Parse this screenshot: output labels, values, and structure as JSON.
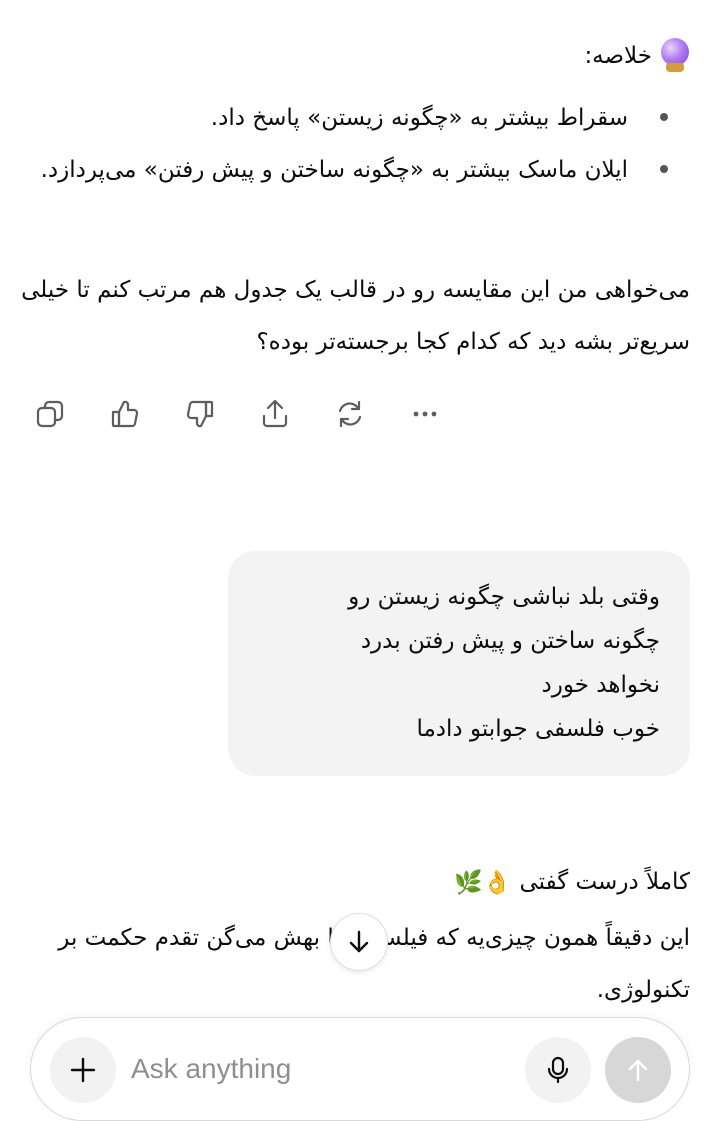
{
  "assistant_message_1": {
    "summary_title": "خلاصه:",
    "summary_icon": "crystal-ball-icon",
    "bullets": [
      "سقراط بیشتر به «چگونه زیستن» پاسخ داد.",
      "ایلان ماسک بیشتر به «چگونه ساختن و پیش رفتن» می‌پردازد."
    ],
    "question": "می‌خواهی من این مقایسه رو در قالب یک جدول هم مرتب کنم تا خیلی سریع‌تر بشه دید که کدام کجا برجسته‌تر بوده؟",
    "actions": [
      "copy-icon",
      "thumbs-up-icon",
      "thumbs-down-icon",
      "share-icon",
      "regenerate-icon",
      "more-icon"
    ]
  },
  "user_message": {
    "lines": [
      "وقتی بلد نباشی چگونه زیستن رو",
      "چگونه ساختن و پیش رفتن بدرد",
      "نخواهد خورد",
      "خوب فلسفی جوابتو دادما"
    ]
  },
  "assistant_message_2": {
    "title": "کاملاً درست گفتی",
    "title_emoji": "👌🌿",
    "body": "این دقیقاً همون چیزی‌یه که فیلسوف‌ها بهش می‌گن تقدم حکمت بر تکنولوژی."
  },
  "composer": {
    "placeholder": "Ask anything",
    "add_icon": "plus-icon",
    "mic_icon": "microphone-icon",
    "send_icon": "arrow-up-icon"
  },
  "colors": {
    "text": "#0d0d0d",
    "bubble": "#f3f3f3",
    "icon": "#5d5d5d",
    "send_disabled": "#d7d7d7"
  }
}
